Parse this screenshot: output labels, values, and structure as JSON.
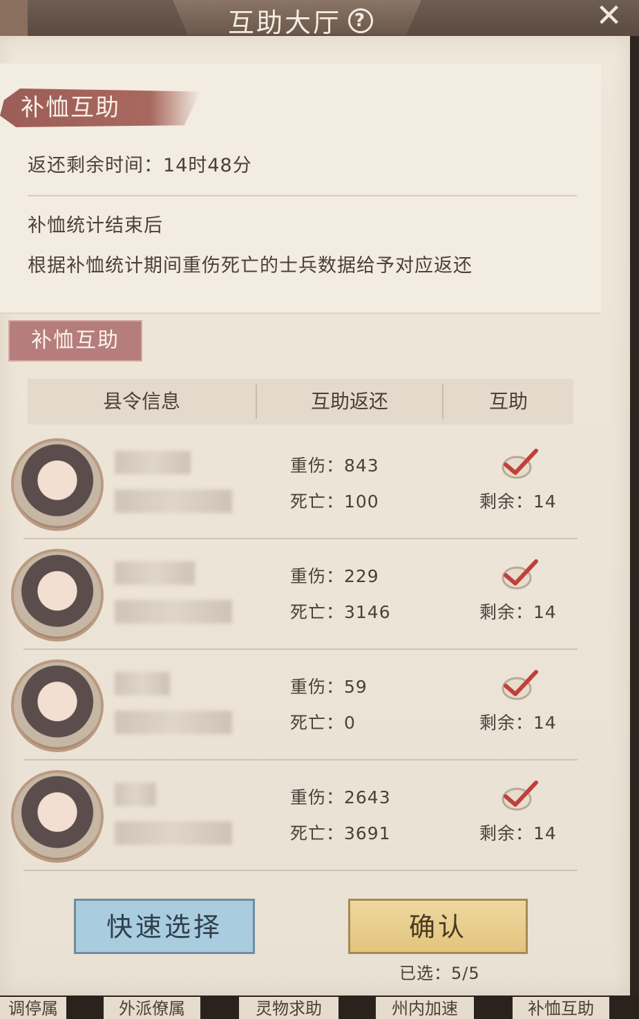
{
  "window": {
    "title": "互助大厅",
    "close_icon": "close-icon",
    "help_icon": "help-icon"
  },
  "info": {
    "section_title": "补恤互助",
    "remaining_time": "返还剩余时间：14时48分",
    "desc_line1": "补恤统计结束后",
    "desc_line2": "根据补恤统计期间重伤死亡的士兵数据给予对应返还"
  },
  "list": {
    "section_tag": "补恤互助",
    "headers": [
      "县令信息",
      "互助返还",
      "互助"
    ],
    "rows": [
      {
        "injured": "重伤：843",
        "dead": "死亡：100",
        "remaining": "剩余：14",
        "checked": true
      },
      {
        "injured": "重伤：229",
        "dead": "死亡：3146",
        "remaining": "剩余：14",
        "checked": true
      },
      {
        "injured": "重伤：59",
        "dead": "死亡：0",
        "remaining": "剩余：14",
        "checked": true
      },
      {
        "injured": "重伤：2643",
        "dead": "死亡：3691",
        "remaining": "剩余：14",
        "checked": true
      }
    ]
  },
  "actions": {
    "quick_select": "快速选择",
    "confirm": "确认",
    "selected_count": "已选：5/5"
  },
  "bottom_tabs": [
    "调停属",
    "外派僚属",
    "灵物求助",
    "州内加速",
    "补恤互助"
  ],
  "colors": {
    "accent_red": "#c0403a",
    "tag_bg": "#b57d7b",
    "quick_btn": "#a9ccdf",
    "confirm_btn": "#e2c47d"
  }
}
